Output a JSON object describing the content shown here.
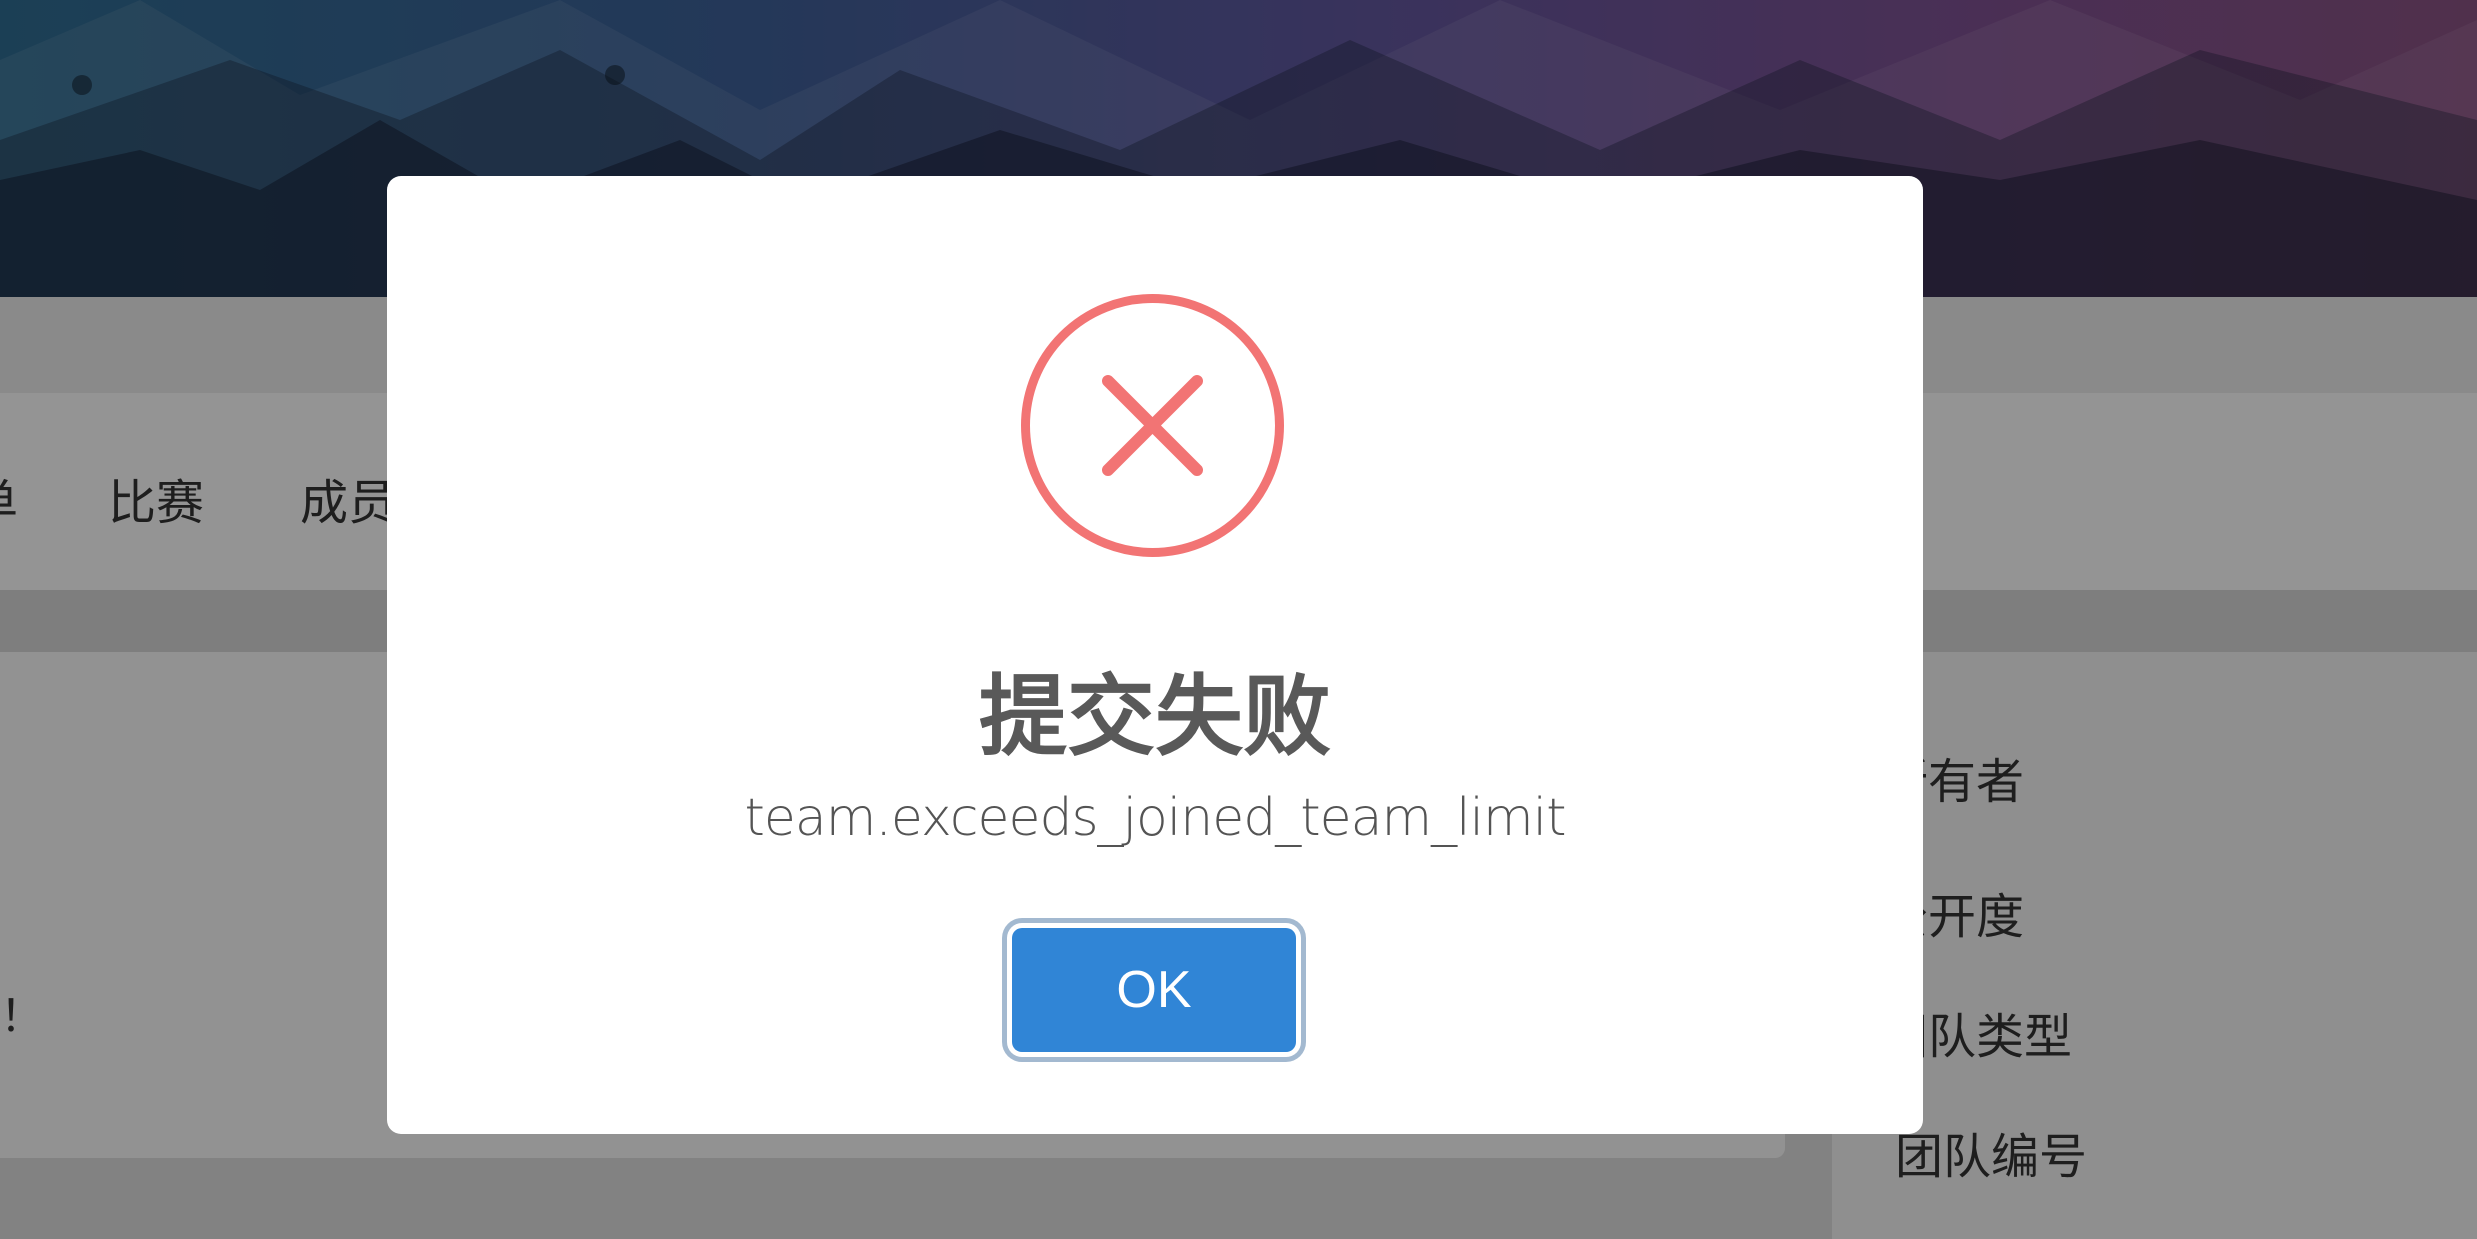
{
  "background": {
    "nav": {
      "items": [
        {
          "label": "单"
        },
        {
          "label": "比赛"
        },
        {
          "label": "成员"
        }
      ]
    },
    "main": {
      "partial_text": "！"
    },
    "side_panel": {
      "labels": [
        "所有者",
        "公开度",
        "团队类型",
        "团队编号"
      ]
    }
  },
  "modal": {
    "icon": "error-x-circle-icon",
    "title": "提交失败",
    "message": "team.exceeds_joined_team_limit",
    "ok_label": "OK"
  },
  "colors": {
    "error": "#f27474",
    "button": "#3085d6",
    "title": "#595959"
  }
}
